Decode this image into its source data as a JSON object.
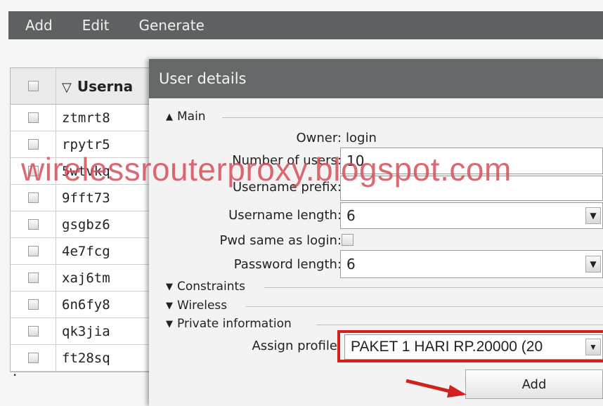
{
  "menu": {
    "items": [
      "Add",
      "Edit",
      "Generate"
    ]
  },
  "users_table": {
    "header": "Userna",
    "rows": [
      "ztmrt8",
      "rpytr5",
      "5wtvkq",
      "9fft73",
      "gsgbz6",
      "4e7fcg",
      "xaj6tm",
      "6n6fy8",
      "qk3jia",
      "ft28sq"
    ]
  },
  "stray_mark": ".",
  "dialog": {
    "title": "User details",
    "sections": {
      "main": "Main",
      "constraints": "Constraints",
      "wireless": "Wireless",
      "private": "Private information"
    },
    "owner": {
      "label": "Owner:",
      "value": "login"
    },
    "num_users": {
      "label": "Number of users:",
      "value": "10"
    },
    "username_prefix": {
      "label": "Username prefix:",
      "value": ""
    },
    "username_length": {
      "label": "Username length:",
      "value": "6"
    },
    "pwd_same": {
      "label": "Pwd same as login:",
      "checked": false
    },
    "password_length": {
      "label": "Password length:",
      "value": "6"
    },
    "assign_profile": {
      "label": "Assign profile:",
      "value": "PAKET 1 HARI RP.20000 (20"
    },
    "add_button": "Add"
  },
  "watermark": "wirelessrouterproxy.blogspot.com",
  "annotation_color": "#d41f1f",
  "icons": {
    "sort": "down-triangle",
    "expanded": "up-triangle",
    "collapsed": "down-triangle",
    "dropdown": "down-triangle"
  }
}
